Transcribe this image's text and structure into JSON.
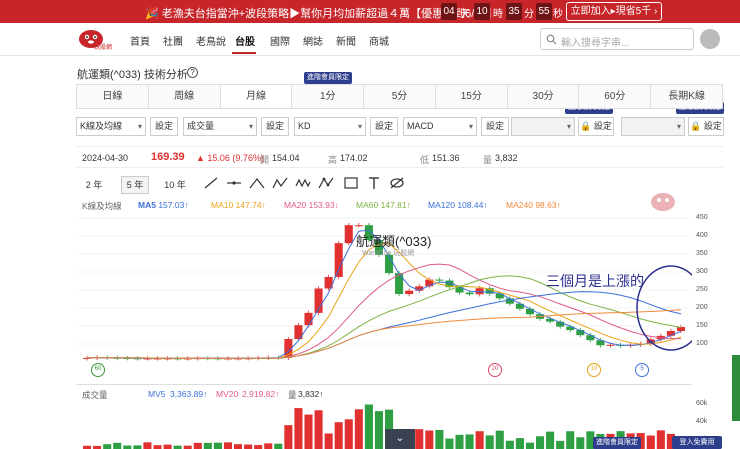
{
  "banner": {
    "promo_text": "🎉 老漁夫台指當沖+波段策略▶幫你月均加薪超過４萬【優惠只到6/13】",
    "countdown": [
      "04",
      "10",
      "35",
      "55"
    ],
    "units": [
      "天",
      "時",
      "分",
      "秒"
    ],
    "cta": "立即加入▸現省5千 ›"
  },
  "header": {
    "logo_text": "玩股網",
    "nav": [
      "首頁",
      "社團",
      "老鳥說",
      "台股",
      "國際",
      "網誌",
      "新聞",
      "商城"
    ],
    "active_nav": "台股",
    "search_placeholder": "輸入搜尋字串..."
  },
  "page": {
    "title": "航運類(^033) 技術分析",
    "help_icon": "help-circle-icon"
  },
  "period_tabs": [
    "日線",
    "周線",
    "月線",
    "1分",
    "5分",
    "15分",
    "30分",
    "60分",
    "長期K線"
  ],
  "active_period": "月線",
  "member_label": "進階會員限定",
  "indicators": {
    "k_select": "K線及均線",
    "vol_select": "成交量",
    "kd_select": "KD",
    "macd_select": "MACD",
    "set_label": "設定",
    "lock_set_label": "🔒 設定"
  },
  "quote": {
    "date": "2024-04-30",
    "close": "169.39",
    "change": "▲ 15.06 (9.76%)",
    "open_label": "開",
    "open": "154.04",
    "high_label": "高",
    "high": "174.02",
    "low_label": "低",
    "low": "151.36",
    "vol_label": "量",
    "volume": "3,832"
  },
  "ranges": [
    "2 年",
    "5 年",
    "10 年"
  ],
  "active_range": "5 年",
  "legend": {
    "label": "K線及均線",
    "items": [
      {
        "text": "MA5",
        "value": "157.03↑",
        "color": "#3b6fd8"
      },
      {
        "text": "MA10",
        "value": "147.74↑",
        "color": "#e8a317"
      },
      {
        "text": "MA20",
        "value": "153.93↓",
        "color": "#e05a8a"
      },
      {
        "text": "MA60",
        "value": "147.81↑",
        "color": "#7cb342"
      },
      {
        "text": "MA120",
        "value": "108.44↑",
        "color": "#3b6fd8"
      },
      {
        "text": "MA240",
        "value": "98.63↑",
        "color": "#f08a3c"
      }
    ]
  },
  "chart": {
    "title": "航運類(^033)",
    "subtitle": "WantGoo 玩股網",
    "annotation": "三個月是上漲的",
    "y_ticks": [
      "450",
      "400",
      "350",
      "300",
      "250",
      "200",
      "150",
      "100"
    ],
    "badges": [
      {
        "text": "60",
        "color": "#3a9a3a"
      },
      {
        "text": "20",
        "color": "#d94a6b"
      },
      {
        "text": "10",
        "color": "#e8a317"
      },
      {
        "text": "5",
        "color": "#3b6fd8"
      }
    ]
  },
  "volume_legend": {
    "label": "成交量",
    "mv5": "MV5",
    "mv5_value": "3,363.89↑",
    "mv20": "MV20",
    "mv20_value": "2,919.82↑",
    "vol_label": "量",
    "vol_value": "3,832↑",
    "y_ticks": [
      "60k",
      "40k",
      "20k"
    ]
  },
  "footer": {
    "scroll_icon": "chevron-down-icon",
    "free_btn": "登入免費用"
  },
  "colors": {
    "brand_red": "#c6262a",
    "member_blue": "#2d3e8c",
    "up_red": "#e03030",
    "down_green": "#2ea043"
  }
}
